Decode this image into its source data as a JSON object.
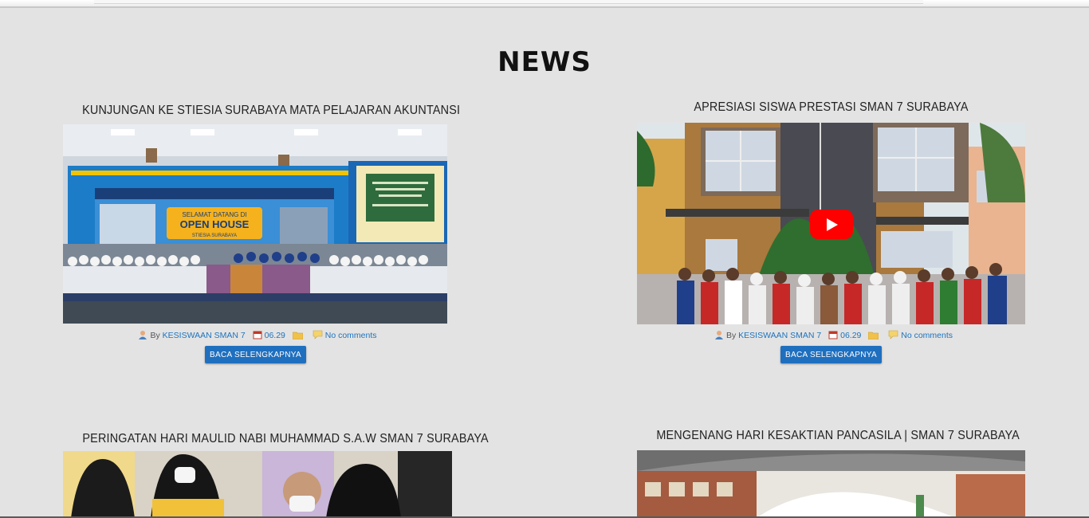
{
  "section": {
    "title": "NEWS"
  },
  "posts": [
    {
      "title": "KUNJUNGAN KE STIESIA SURABAYA MATA PELAJARAN AKUNTANSI",
      "by": "By",
      "author": "KESISWAAN SMAN 7",
      "time": "06.29",
      "comments": "No comments",
      "button": "BACA SELENGKAPNYA",
      "image_banner_top": "SELAMAT DATANG DI",
      "image_banner_main": "OPEN HOUSE",
      "image_banner_sub": "STIESIA SURABAYA"
    },
    {
      "title": "APRESIASI SISWA PRESTASI SMAN 7 SURABAYA",
      "by": "By",
      "author": "KESISWAAN SMAN 7",
      "time": "06.29",
      "comments": "No comments",
      "button": "BACA SELENGKAPNYA"
    },
    {
      "title": "PERINGATAN HARI MAULID NABI MUHAMMAD S.A.W SMAN 7 SURABAYA"
    },
    {
      "title": "MENGENANG HARI KESAKTIAN PANCASILA | SMAN 7 SURABAYA"
    }
  ],
  "icons": {
    "author": "user-icon",
    "date": "calendar-icon",
    "category": "folder-icon",
    "comments": "comment-icon",
    "video": "youtube-play-icon"
  },
  "colors": {
    "background": "#e3e3e3",
    "link": "#1e73be",
    "button": "#1f6fbf",
    "youtube": "#ff0000"
  }
}
